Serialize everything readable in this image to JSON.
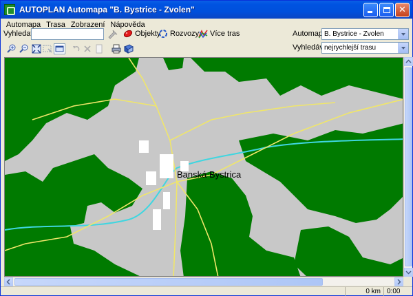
{
  "window": {
    "title": "AUTOPLAN Automapa \"B. Bystrice - Zvolen\""
  },
  "menu": {
    "items": [
      "Automapa",
      "Trasa",
      "Zobrazení",
      "Nápověda"
    ]
  },
  "search": {
    "label": "Vyhledat:",
    "value": "",
    "placeholder": ""
  },
  "toolbar": {
    "objekty_label": "Objekty",
    "rozvozy_label": "Rozvozy",
    "vice_tras_label": "Více tras",
    "automapa_label": "Automapa",
    "automapa_value": "B. Bystrice - Zvolen",
    "vyhledavat_label": "Vyhledávat",
    "vyhledavat_value": "nejrychlejší trasu"
  },
  "map": {
    "city_label": "Banská Bystrica",
    "colors": {
      "forest": "#007a00",
      "urban": "#c8c8c8",
      "road": "#f0e66a",
      "water": "#3fd6e0"
    }
  },
  "status": {
    "distance": "0 km",
    "time": "0:00"
  },
  "icons": [
    "app-icon",
    "zoom-in-icon",
    "zoom-out-icon",
    "zoom-extent-icon",
    "zoom-window-icon",
    "map-frame-icon",
    "undo-icon",
    "delete-icon",
    "page-icon",
    "print-icon",
    "book-icon",
    "objects-pin-icon",
    "rozvozy-icon",
    "multi-route-icon",
    "search-go-icon"
  ]
}
